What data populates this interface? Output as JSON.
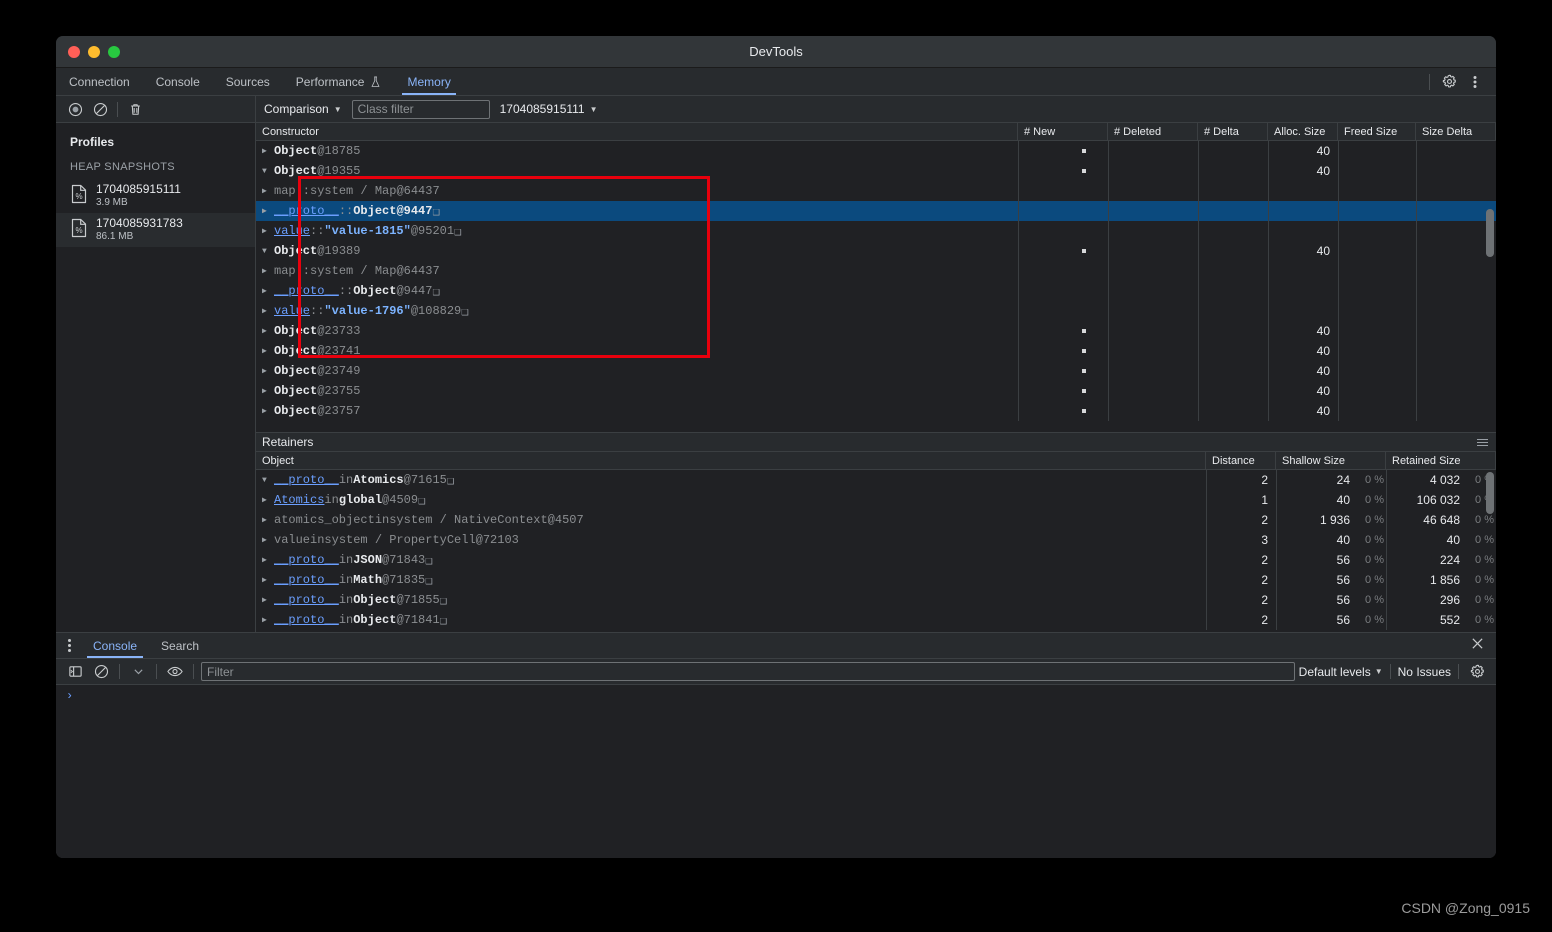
{
  "window": {
    "title": "DevTools"
  },
  "main_tabs": [
    {
      "label": "Connection",
      "active": false,
      "icon": ""
    },
    {
      "label": "Console",
      "active": false,
      "icon": ""
    },
    {
      "label": "Sources",
      "active": false,
      "icon": ""
    },
    {
      "label": "Performance",
      "active": false,
      "icon": "flask-icon"
    },
    {
      "label": "Memory",
      "active": true,
      "icon": ""
    }
  ],
  "tabbar_right": {
    "settings_icon": "gear-icon",
    "more_icon": "kebab-menu-icon"
  },
  "memory_toolbar": {
    "record_icon": "record-icon",
    "clear_icon": "clear-icon",
    "delete_icon": "trash-icon",
    "view_mode": "Comparison",
    "class_filter_placeholder": "Class filter",
    "baseline_snapshot": "1704085915111"
  },
  "sidebar": {
    "title": "Profiles",
    "group_label": "HEAP SNAPSHOTS",
    "snapshots": [
      {
        "name": "1704085915111",
        "size": "3.9 MB",
        "selected": false
      },
      {
        "name": "1704085931783",
        "size": "86.1 MB",
        "selected": true
      }
    ]
  },
  "constructor_grid": {
    "columns": [
      "Constructor",
      "# New",
      "# Deleted",
      "# Delta",
      "Alloc. Size",
      "Freed Size",
      "Size Delta"
    ],
    "rows": [
      {
        "indent": 0,
        "arrow": "right",
        "tokens": [
          {
            "t": "Object",
            "c": "tk-obj"
          },
          {
            "t": " @18785",
            "c": "tk-dim"
          }
        ],
        "new_dot": true,
        "deleted": "",
        "delta": "",
        "alloc": "40",
        "freed": "",
        "size_delta": "",
        "selected": false
      },
      {
        "indent": 0,
        "arrow": "down",
        "tokens": [
          {
            "t": "Object",
            "c": "tk-obj"
          },
          {
            "t": " @19355",
            "c": "tk-dim"
          }
        ],
        "new_dot": true,
        "deleted": "",
        "delta": "",
        "alloc": "40",
        "freed": "",
        "size_delta": "",
        "selected": false
      },
      {
        "indent": 1,
        "arrow": "right",
        "tokens": [
          {
            "t": "map",
            "c": "tk-propdim"
          },
          {
            "t": " :: ",
            "c": "tk-sym"
          },
          {
            "t": "system / Map",
            "c": "tk-propdim"
          },
          {
            "t": " @64437",
            "c": "tk-dim"
          }
        ],
        "new_dot": false,
        "deleted": "",
        "delta": "",
        "alloc": "",
        "freed": "",
        "size_delta": "",
        "selected": false
      },
      {
        "indent": 1,
        "arrow": "right",
        "tokens": [
          {
            "t": "__proto__",
            "c": "tk-prop"
          },
          {
            "t": " :: ",
            "c": "tk-sym"
          },
          {
            "t": "Object",
            "c": "tk-white"
          },
          {
            "t": " @9447",
            "c": "tk-white"
          },
          {
            "t": " ❑",
            "c": "tk-box"
          }
        ],
        "new_dot": false,
        "deleted": "",
        "delta": "",
        "alloc": "",
        "freed": "",
        "size_delta": "",
        "selected": true
      },
      {
        "indent": 1,
        "arrow": "right",
        "tokens": [
          {
            "t": "value",
            "c": "tk-prop"
          },
          {
            "t": " :: ",
            "c": "tk-sym"
          },
          {
            "t": "\"value-1815\"",
            "c": "tk-str"
          },
          {
            "t": " @95201",
            "c": "tk-dim"
          },
          {
            "t": " ❑",
            "c": "tk-box"
          }
        ],
        "new_dot": false,
        "deleted": "",
        "delta": "",
        "alloc": "",
        "freed": "",
        "size_delta": "",
        "selected": false
      },
      {
        "indent": 0,
        "arrow": "down",
        "tokens": [
          {
            "t": "Object",
            "c": "tk-obj"
          },
          {
            "t": " @19389",
            "c": "tk-dim"
          }
        ],
        "new_dot": true,
        "deleted": "",
        "delta": "",
        "alloc": "40",
        "freed": "",
        "size_delta": "",
        "selected": false
      },
      {
        "indent": 1,
        "arrow": "right",
        "tokens": [
          {
            "t": "map",
            "c": "tk-propdim"
          },
          {
            "t": " :: ",
            "c": "tk-sym"
          },
          {
            "t": "system / Map",
            "c": "tk-propdim"
          },
          {
            "t": " @64437",
            "c": "tk-dim"
          }
        ],
        "new_dot": false,
        "deleted": "",
        "delta": "",
        "alloc": "",
        "freed": "",
        "size_delta": "",
        "selected": false
      },
      {
        "indent": 1,
        "arrow": "right",
        "tokens": [
          {
            "t": "__proto__",
            "c": "tk-prop"
          },
          {
            "t": " :: ",
            "c": "tk-sym"
          },
          {
            "t": "Object",
            "c": "tk-white"
          },
          {
            "t": " @9447",
            "c": "tk-dim"
          },
          {
            "t": " ❑",
            "c": "tk-box"
          }
        ],
        "new_dot": false,
        "deleted": "",
        "delta": "",
        "alloc": "",
        "freed": "",
        "size_delta": "",
        "selected": false
      },
      {
        "indent": 1,
        "arrow": "right",
        "tokens": [
          {
            "t": "value",
            "c": "tk-prop"
          },
          {
            "t": " :: ",
            "c": "tk-sym"
          },
          {
            "t": "\"value-1796\"",
            "c": "tk-str"
          },
          {
            "t": " @108829",
            "c": "tk-dim"
          },
          {
            "t": " ❑",
            "c": "tk-box"
          }
        ],
        "new_dot": false,
        "deleted": "",
        "delta": "",
        "alloc": "",
        "freed": "",
        "size_delta": "",
        "selected": false
      },
      {
        "indent": 0,
        "arrow": "right",
        "tokens": [
          {
            "t": "Object",
            "c": "tk-obj"
          },
          {
            "t": " @23733",
            "c": "tk-dim"
          }
        ],
        "new_dot": true,
        "deleted": "",
        "delta": "",
        "alloc": "40",
        "freed": "",
        "size_delta": "",
        "selected": false
      },
      {
        "indent": 0,
        "arrow": "right",
        "tokens": [
          {
            "t": "Object",
            "c": "tk-obj"
          },
          {
            "t": " @23741",
            "c": "tk-dim"
          }
        ],
        "new_dot": true,
        "deleted": "",
        "delta": "",
        "alloc": "40",
        "freed": "",
        "size_delta": "",
        "selected": false
      },
      {
        "indent": 0,
        "arrow": "right",
        "tokens": [
          {
            "t": "Object",
            "c": "tk-obj"
          },
          {
            "t": " @23749",
            "c": "tk-dim"
          }
        ],
        "new_dot": true,
        "deleted": "",
        "delta": "",
        "alloc": "40",
        "freed": "",
        "size_delta": "",
        "selected": false
      },
      {
        "indent": 0,
        "arrow": "right",
        "tokens": [
          {
            "t": "Object",
            "c": "tk-obj"
          },
          {
            "t": " @23755",
            "c": "tk-dim"
          }
        ],
        "new_dot": true,
        "deleted": "",
        "delta": "",
        "alloc": "40",
        "freed": "",
        "size_delta": "",
        "selected": false
      },
      {
        "indent": 0,
        "arrow": "right",
        "tokens": [
          {
            "t": "Object",
            "c": "tk-obj"
          },
          {
            "t": " @23757",
            "c": "tk-dim"
          }
        ],
        "new_dot": true,
        "deleted": "",
        "delta": "",
        "alloc": "40",
        "freed": "",
        "size_delta": "",
        "selected": false
      }
    ]
  },
  "retainers": {
    "panel_title": "Retainers",
    "menu_icon": "hamburger-icon",
    "columns": [
      "Object",
      "Distance",
      "Shallow Size",
      "Retained Size"
    ],
    "rows": [
      {
        "indent": 0,
        "arrow": "down",
        "tokens": [
          {
            "t": "__proto__",
            "c": "tk-prop"
          },
          {
            "t": " in ",
            "c": "tk-dim"
          },
          {
            "t": "Atomics",
            "c": "tk-white"
          },
          {
            "t": " @71615",
            "c": "tk-dim"
          },
          {
            "t": " ❑",
            "c": "tk-box"
          }
        ],
        "distance": "2",
        "shallow": "24",
        "shallow_pct": "0 %",
        "retained": "4 032",
        "retained_pct": "0 %"
      },
      {
        "indent": 1,
        "arrow": "right",
        "tokens": [
          {
            "t": "Atomics",
            "c": "tk-prop"
          },
          {
            "t": " in ",
            "c": "tk-dim"
          },
          {
            "t": "global",
            "c": "tk-white"
          },
          {
            "t": " @4509",
            "c": "tk-dim"
          },
          {
            "t": " ❑",
            "c": "tk-box"
          }
        ],
        "distance": "1",
        "shallow": "40",
        "shallow_pct": "0 %",
        "retained": "106 032",
        "retained_pct": "0 %"
      },
      {
        "indent": 1,
        "arrow": "right",
        "tokens": [
          {
            "t": "atomics_object",
            "c": "tk-propdim"
          },
          {
            "t": " in ",
            "c": "tk-dim"
          },
          {
            "t": "system / NativeContext",
            "c": "tk-propdim"
          },
          {
            "t": " @4507",
            "c": "tk-dim"
          }
        ],
        "distance": "2",
        "shallow": "1 936",
        "shallow_pct": "0 %",
        "retained": "46 648",
        "retained_pct": "0 %"
      },
      {
        "indent": 1,
        "arrow": "right",
        "tokens": [
          {
            "t": "value",
            "c": "tk-propdim"
          },
          {
            "t": " in ",
            "c": "tk-dim"
          },
          {
            "t": "system / PropertyCell",
            "c": "tk-propdim"
          },
          {
            "t": " @72103",
            "c": "tk-dim"
          }
        ],
        "distance": "3",
        "shallow": "40",
        "shallow_pct": "0 %",
        "retained": "40",
        "retained_pct": "0 %"
      },
      {
        "indent": 0,
        "arrow": "right",
        "tokens": [
          {
            "t": "__proto__",
            "c": "tk-prop"
          },
          {
            "t": " in ",
            "c": "tk-dim"
          },
          {
            "t": "JSON",
            "c": "tk-white"
          },
          {
            "t": " @71843",
            "c": "tk-dim"
          },
          {
            "t": " ❑",
            "c": "tk-box"
          }
        ],
        "distance": "2",
        "shallow": "56",
        "shallow_pct": "0 %",
        "retained": "224",
        "retained_pct": "0 %"
      },
      {
        "indent": 0,
        "arrow": "right",
        "tokens": [
          {
            "t": "__proto__",
            "c": "tk-prop"
          },
          {
            "t": " in ",
            "c": "tk-dim"
          },
          {
            "t": "Math",
            "c": "tk-white"
          },
          {
            "t": " @71835",
            "c": "tk-dim"
          },
          {
            "t": " ❑",
            "c": "tk-box"
          }
        ],
        "distance": "2",
        "shallow": "56",
        "shallow_pct": "0 %",
        "retained": "1 856",
        "retained_pct": "0 %"
      },
      {
        "indent": 0,
        "arrow": "right",
        "tokens": [
          {
            "t": "__proto__",
            "c": "tk-prop"
          },
          {
            "t": " in ",
            "c": "tk-dim"
          },
          {
            "t": "Object",
            "c": "tk-white"
          },
          {
            "t": " @71855",
            "c": "tk-dim"
          },
          {
            "t": " ❑",
            "c": "tk-box"
          }
        ],
        "distance": "2",
        "shallow": "56",
        "shallow_pct": "0 %",
        "retained": "296",
        "retained_pct": "0 %"
      },
      {
        "indent": 0,
        "arrow": "right",
        "tokens": [
          {
            "t": "__proto__",
            "c": "tk-prop"
          },
          {
            "t": " in ",
            "c": "tk-dim"
          },
          {
            "t": "Object",
            "c": "tk-white"
          },
          {
            "t": " @71841",
            "c": "tk-dim"
          },
          {
            "t": " ❑",
            "c": "tk-box"
          }
        ],
        "distance": "2",
        "shallow": "56",
        "shallow_pct": "0 %",
        "retained": "552",
        "retained_pct": "0 %"
      }
    ]
  },
  "drawer": {
    "more_icon": "kebab-menu-icon",
    "tabs": [
      {
        "label": "Console",
        "active": true
      },
      {
        "label": "Search",
        "active": false
      }
    ],
    "close_icon": "close-icon",
    "toolbar": {
      "sidebar_icon": "console-sidebar-icon",
      "clear_icon": "clear-console-icon",
      "context_caret": "chevron-down-icon",
      "eye_icon": "live-expression-icon",
      "filter_placeholder": "Filter",
      "levels_label": "Default levels",
      "issues_label": "No Issues",
      "settings_icon": "gear-icon"
    },
    "prompt_symbol": "›"
  },
  "annotation": {
    "highlight_color": "#e8000d"
  },
  "watermark": {
    "text": "CSDN @Zong_0915"
  }
}
